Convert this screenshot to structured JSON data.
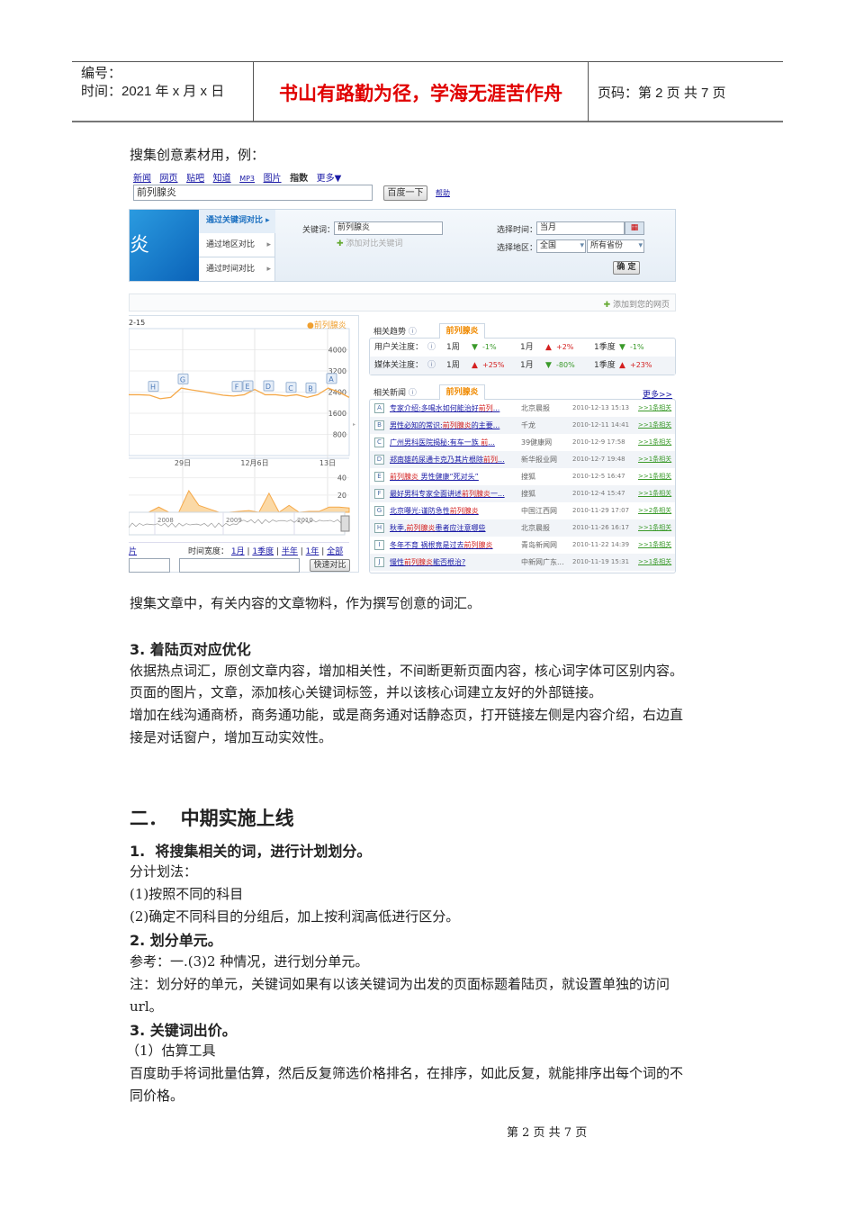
{
  "header": {
    "number_label": "编号：",
    "time_label": "时间：2021 年 x 月 x 日",
    "motto": "书山有路勤为径，学海无涯苦作舟",
    "page_label": "页码：第 2 页  共 7 页"
  },
  "intro": "搜集创意素材用，例：",
  "screenshot": {
    "nav": [
      "新闻",
      "网页",
      "贴吧",
      "知道",
      "MP3",
      "图片",
      "指数",
      "更多▼"
    ],
    "search_value": "前列腺炎",
    "search_button": "百度一下",
    "help": "帮助",
    "banner_char": "炎",
    "menu": [
      "通过关键词对比",
      "通过地区对比",
      "通过时间对比"
    ],
    "keyword_label": "关键词：",
    "keyword_value": "前列腺炎",
    "add_keyword": "添加对比关键词",
    "time_label": "选择时间：",
    "time_value": "当月",
    "area_label": "选择地区：",
    "area_value": "全国",
    "province_value": "所有省份",
    "confirm": "确 定",
    "add_to_page": "添加到您的网页",
    "chart": {
      "date_fragment": "2-15",
      "legend": "●前列腺炎",
      "y_ticks": [
        "4000",
        "3200",
        "2400",
        "1600",
        "800"
      ],
      "x_ticks": [
        "29日",
        "12月6日",
        "13日"
      ],
      "lower_ticks": [
        "40",
        "20"
      ],
      "years": [
        "2008",
        "2009",
        "2010"
      ],
      "markers": [
        "H",
        "G",
        "F",
        "E",
        "D",
        "C",
        "B",
        "A"
      ],
      "trend": [
        2300,
        2300,
        2280,
        2150,
        2200,
        2550,
        2480,
        2420,
        2350,
        2280,
        2250,
        2300,
        2500,
        2300,
        2300,
        2250,
        2300,
        2200,
        2300,
        2550,
        2400,
        2200
      ],
      "media": [
        0,
        0,
        0,
        6,
        0,
        0,
        25,
        8,
        4,
        0,
        0,
        1,
        2,
        0,
        22,
        0,
        8,
        0,
        1,
        1,
        6,
        6,
        5
      ]
    },
    "time_width_label": "时间宽度：",
    "time_widths": [
      "1月",
      "1季度",
      "半年",
      "1年",
      "全部"
    ],
    "left_link": "片",
    "quick_compare": "快速对比",
    "trend_title": "相关趋势",
    "tab_keyword": "前列腺炎",
    "trends": [
      {
        "label": "用户关注度：",
        "items": [
          {
            "p": "1周",
            "v": "-1%",
            "dir": "down"
          },
          {
            "p": "1月",
            "v": "+2%",
            "dir": "up"
          },
          {
            "p": "1季度",
            "v": "-1%",
            "dir": "down"
          }
        ]
      },
      {
        "label": "媒体关注度：",
        "items": [
          {
            "p": "1周",
            "v": "+25%",
            "dir": "up"
          },
          {
            "p": "1月",
            "v": "-80%",
            "dir": "down"
          },
          {
            "p": "1季度",
            "v": "+23%",
            "dir": "up"
          }
        ]
      }
    ],
    "news_title": "相关新闻",
    "more": "更多>>",
    "news": [
      {
        "l": "A",
        "pre": "专家介绍:多喝水如何能治好",
        "kw": "前列",
        "post": "...",
        "src": "北京晨报",
        "time": "2010-12-13 15:13",
        "rel": ">>1条相关"
      },
      {
        "l": "B",
        "pre": "男性必知的常识:",
        "kw": "前列腺炎",
        "post": "的主要...",
        "src": "千龙",
        "time": "2010-12-11 14:41",
        "rel": ">>1条相关"
      },
      {
        "l": "C",
        "pre": "广州男科医院揭秘:有车一族 ",
        "kw": "前",
        "post": "...",
        "src": "39健康网",
        "time": "2010-12-9 17:58",
        "rel": ">>1条相关"
      },
      {
        "l": "D",
        "pre": "郑南雄药尿通卡克乃其片根除",
        "kw": "前列",
        "post": "...",
        "src": "新华报业网",
        "time": "2010-12-7 19:48",
        "rel": ">>1条相关"
      },
      {
        "l": "E",
        "pre": "",
        "kw": "前列腺炎",
        "post": " 男性健康“死对头”",
        "src": "搜狐",
        "time": "2010-12-5 16:47",
        "rel": ">>1条相关"
      },
      {
        "l": "F",
        "pre": "最好男科专家全面讲述",
        "kw": "前列腺炎",
        "post": "一...",
        "src": "搜狐",
        "time": "2010-12-4 15:47",
        "rel": ">>1条相关"
      },
      {
        "l": "G",
        "pre": "北京曝光:谨防急性",
        "kw": "前列腺炎",
        "post": "",
        "src": "中国江西网",
        "time": "2010-11-29 17:07",
        "rel": ">>2条相关"
      },
      {
        "l": "H",
        "pre": "秋季,",
        "kw": "前列腺炎",
        "post": "患者应注意哪些",
        "src": "北京晨报",
        "time": "2010-11-26 16:17",
        "rel": ">>1条相关"
      },
      {
        "l": "I",
        "pre": "冬年不育 祸根竟是过去",
        "kw": "前列腺炎",
        "post": "",
        "src": "青岛新闻网",
        "time": "2010-11-22 14:39",
        "rel": ">>1条相关"
      },
      {
        "l": "J",
        "pre": "慢性",
        "kw": "前列腺炎",
        "post": "能否根治?",
        "src": "中新网广东...",
        "time": "2010-11-19 15:31",
        "rel": ">>1条相关"
      }
    ]
  },
  "body": {
    "p1": "搜集文章中，有关内容的文章物料，作为撰写创意的词汇。",
    "h3": "3. 着陆页对应优化",
    "l1": "依据热点词汇，原创文章内容，增加相关性，不间断更新页面内容，核心词字体可区别内容。",
    "l2": "页面的图片，文章，添加核心关键词标签，并以该核心词建立友好的外部链接。",
    "l3": "增加在线沟通商桥，商务通功能，或是商务通对话静态页，打开链接左侧是内容介绍，右边直",
    "l4": "接是对话窗户，增加互动实效性。",
    "h2": "二．  中期实施上线",
    "s1": "1.  将搜集相关的词，进行计划划分。",
    "s1a": "分计划法：",
    "s1b": "(1)按照不同的科目",
    "s1c": "(2)确定不同科目的分组后，加上按利润高低进行区分。",
    "s2": "2. 划分单元。",
    "s2a": "参考：一.(3)2 种情况，进行划分单元。",
    "s2b": "注：划分好的单元，关键词如果有以该关键词为出发的页面标题着陆页，就设置单独的访问",
    "s2c": "url。",
    "s3": "3. 关键词出价。",
    "s3a": "（1）估算工具",
    "s3b": "百度助手将词批量估算，然后反复筛选价格排名，在排序，如此反复，就能排序出每个词的不",
    "s3c": "同价格。"
  },
  "footer": "第 2 页 共 7 页"
}
